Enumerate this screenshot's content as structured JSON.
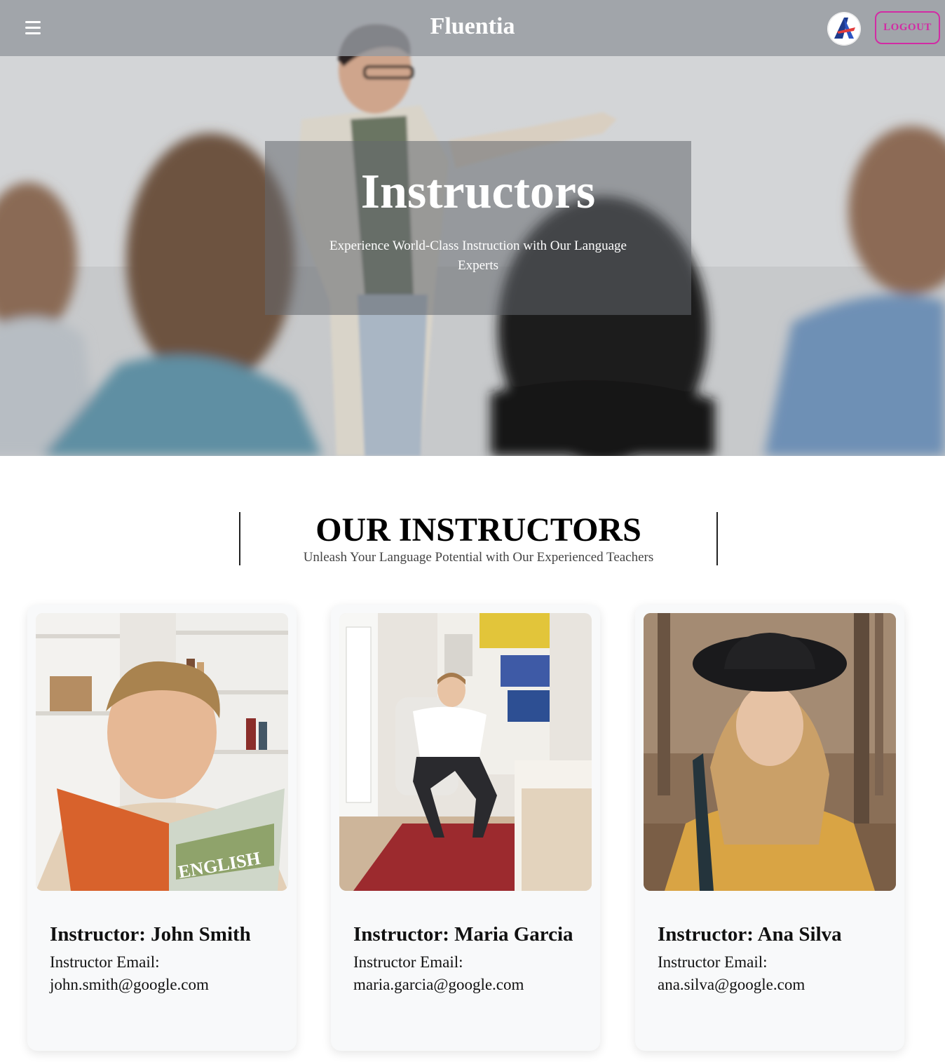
{
  "header": {
    "menu_icon": "hamburger-icon",
    "brand": "Fluentia",
    "logo_icon": "app-logo-a",
    "logout_label": "LOGOUT"
  },
  "hero": {
    "title": "Instructors",
    "subtitle": "Experience World-Class Instruction with Our Language Experts"
  },
  "section": {
    "title": "OUR INSTRUCTORS",
    "subtitle": "Unleash Your Language Potential with Our Experienced Teachers"
  },
  "instructors": [
    {
      "name": "Instructor: John Smith",
      "email_label": "Instructor Email:",
      "email": "john.smith@google.com"
    },
    {
      "name": "Instructor: Maria Garcia",
      "email_label": "Instructor Email:",
      "email": "maria.garcia@google.com"
    },
    {
      "name": "Instructor: Ana Silva",
      "email_label": "Instructor Email:",
      "email": "ana.silva@google.com"
    }
  ],
  "colors": {
    "accent": "#d22ba4",
    "card_bg": "#f8f9fa",
    "header_overlay": "#969aa0"
  }
}
